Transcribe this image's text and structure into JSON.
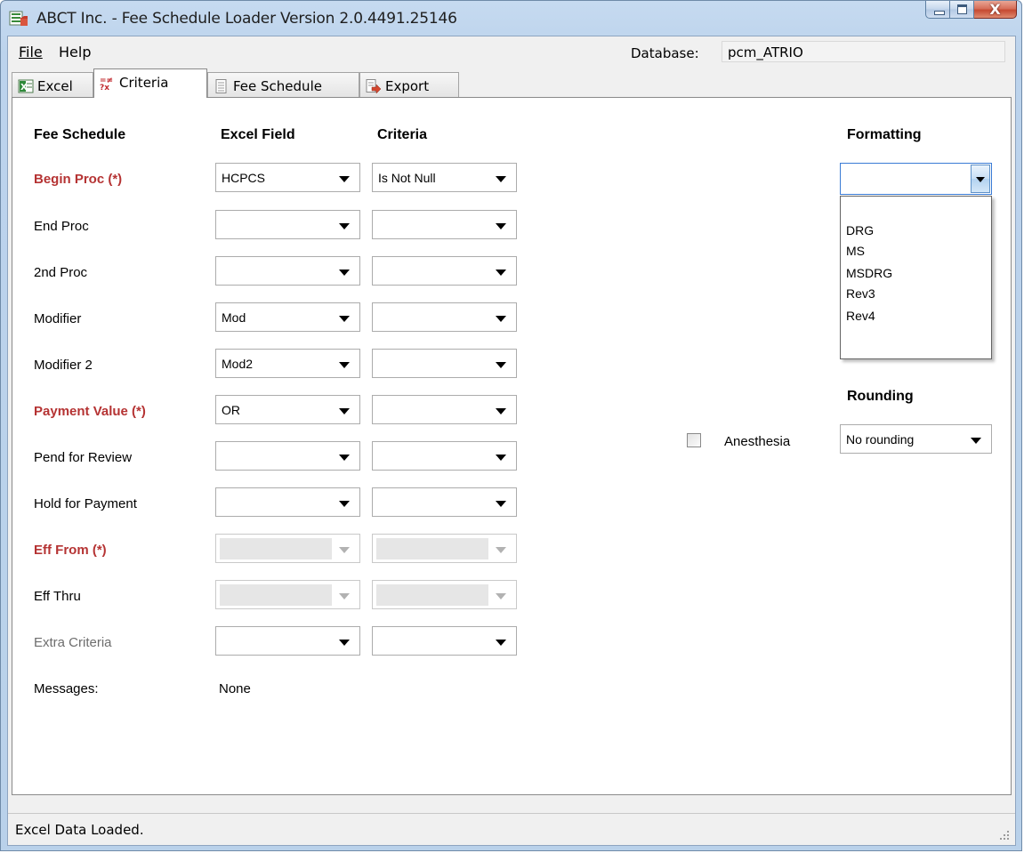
{
  "window": {
    "title": "ABCT Inc. - Fee Schedule Loader Version 2.0.4491.25146",
    "close_glyph": "X"
  },
  "menu": {
    "file": "File",
    "help": "Help"
  },
  "database": {
    "label": "Database:",
    "value": "pcm_ATRIO"
  },
  "tabs": [
    {
      "label": "Excel",
      "icon": "excel-icon"
    },
    {
      "label": "Criteria",
      "icon": "criteria-icon"
    },
    {
      "label": "Fee Schedule",
      "icon": "document-icon"
    },
    {
      "label": "Export",
      "icon": "export-icon"
    }
  ],
  "headers": {
    "fee_schedule": "Fee Schedule",
    "excel_field": "Excel Field",
    "criteria": "Criteria",
    "formatting": "Formatting",
    "rounding": "Rounding"
  },
  "rows": [
    {
      "label": "Begin Proc (*)",
      "excel_field": "HCPCS",
      "criteria": "Is Not Null"
    },
    {
      "label": "End Proc",
      "excel_field": "",
      "criteria": ""
    },
    {
      "label": "2nd Proc",
      "excel_field": "",
      "criteria": ""
    },
    {
      "label": "Modifier",
      "excel_field": "Mod",
      "criteria": ""
    },
    {
      "label": "Modifier 2",
      "excel_field": "Mod2",
      "criteria": ""
    },
    {
      "label": "Payment Value (*)",
      "excel_field": "OR",
      "criteria": ""
    },
    {
      "label": "Pend for Review",
      "excel_field": "",
      "criteria": ""
    },
    {
      "label": "Hold for Payment",
      "excel_field": "",
      "criteria": ""
    },
    {
      "label": "Eff From (*)",
      "excel_field": "",
      "criteria": ""
    },
    {
      "label": "Eff Thru",
      "excel_field": "",
      "criteria": ""
    },
    {
      "label": "Extra Criteria",
      "excel_field": "",
      "criteria": ""
    }
  ],
  "formatting": {
    "value": "",
    "options": [
      "",
      "DRG",
      "MS",
      "MSDRG",
      "Rev3",
      "Rev4"
    ]
  },
  "anesthesia": {
    "label": "Anesthesia",
    "checked": false
  },
  "rounding": {
    "value": "No rounding"
  },
  "messages": {
    "label": "Messages:",
    "value": "None"
  },
  "status": {
    "text": "Excel Data Loaded."
  },
  "colors": {
    "required_label": "#b53333",
    "focus_border": "#3a7bd5"
  }
}
